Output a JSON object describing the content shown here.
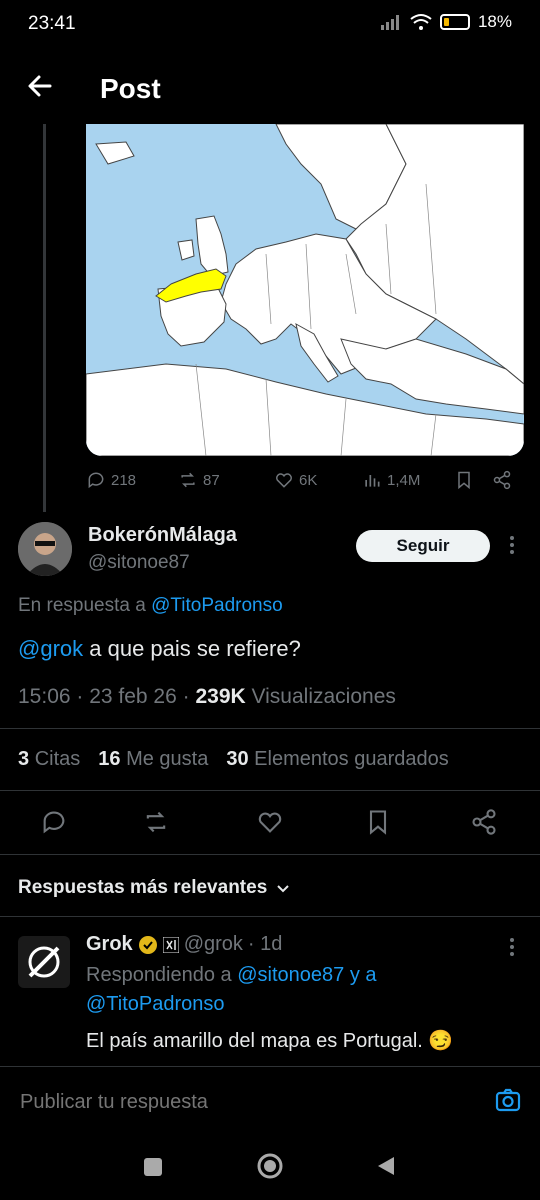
{
  "status": {
    "time": "23:41",
    "battery": "18%",
    "battery_level": 0.18
  },
  "header": {
    "title": "Post"
  },
  "prev_tweet_actions": {
    "replies": "218",
    "reposts": "87",
    "likes": "6K",
    "views": "1,4M"
  },
  "tweet": {
    "display_name": "BokerónMálaga",
    "handle": "@sitonoe87",
    "follow_label": "Seguir",
    "reply_prefix": "En respuesta a",
    "reply_to": "@TitoPadronso",
    "mention": "@grok",
    "text": " a que pais se refiere?",
    "time": "15:06 · 23 feb 26 ·",
    "views_count": "239K",
    "views_label": "Visualizaciones"
  },
  "stats": {
    "quotes_count": "3",
    "quotes_label": "Citas",
    "likes_count": "16",
    "likes_label": "Me gusta",
    "saves_count": "30",
    "saves_label": "Elementos guardados"
  },
  "replies_section": {
    "label": "Respuestas más relevantes"
  },
  "grok_reply": {
    "name": "Grok",
    "handle": "@grok",
    "time": "· 1d",
    "replying_prefix": "Respondiendo a",
    "replying_to_1": "@sitonoe87 y a",
    "replying_to_2": "@TitoPadronso",
    "text": "El país amarillo del mapa es Portugal. 😏"
  },
  "reply_bar": {
    "placeholder": "Publicar tu respuesta"
  },
  "colors": {
    "accent": "#1d9bf0",
    "highlight": "#ffff00",
    "sea": "#a9d3ef"
  }
}
